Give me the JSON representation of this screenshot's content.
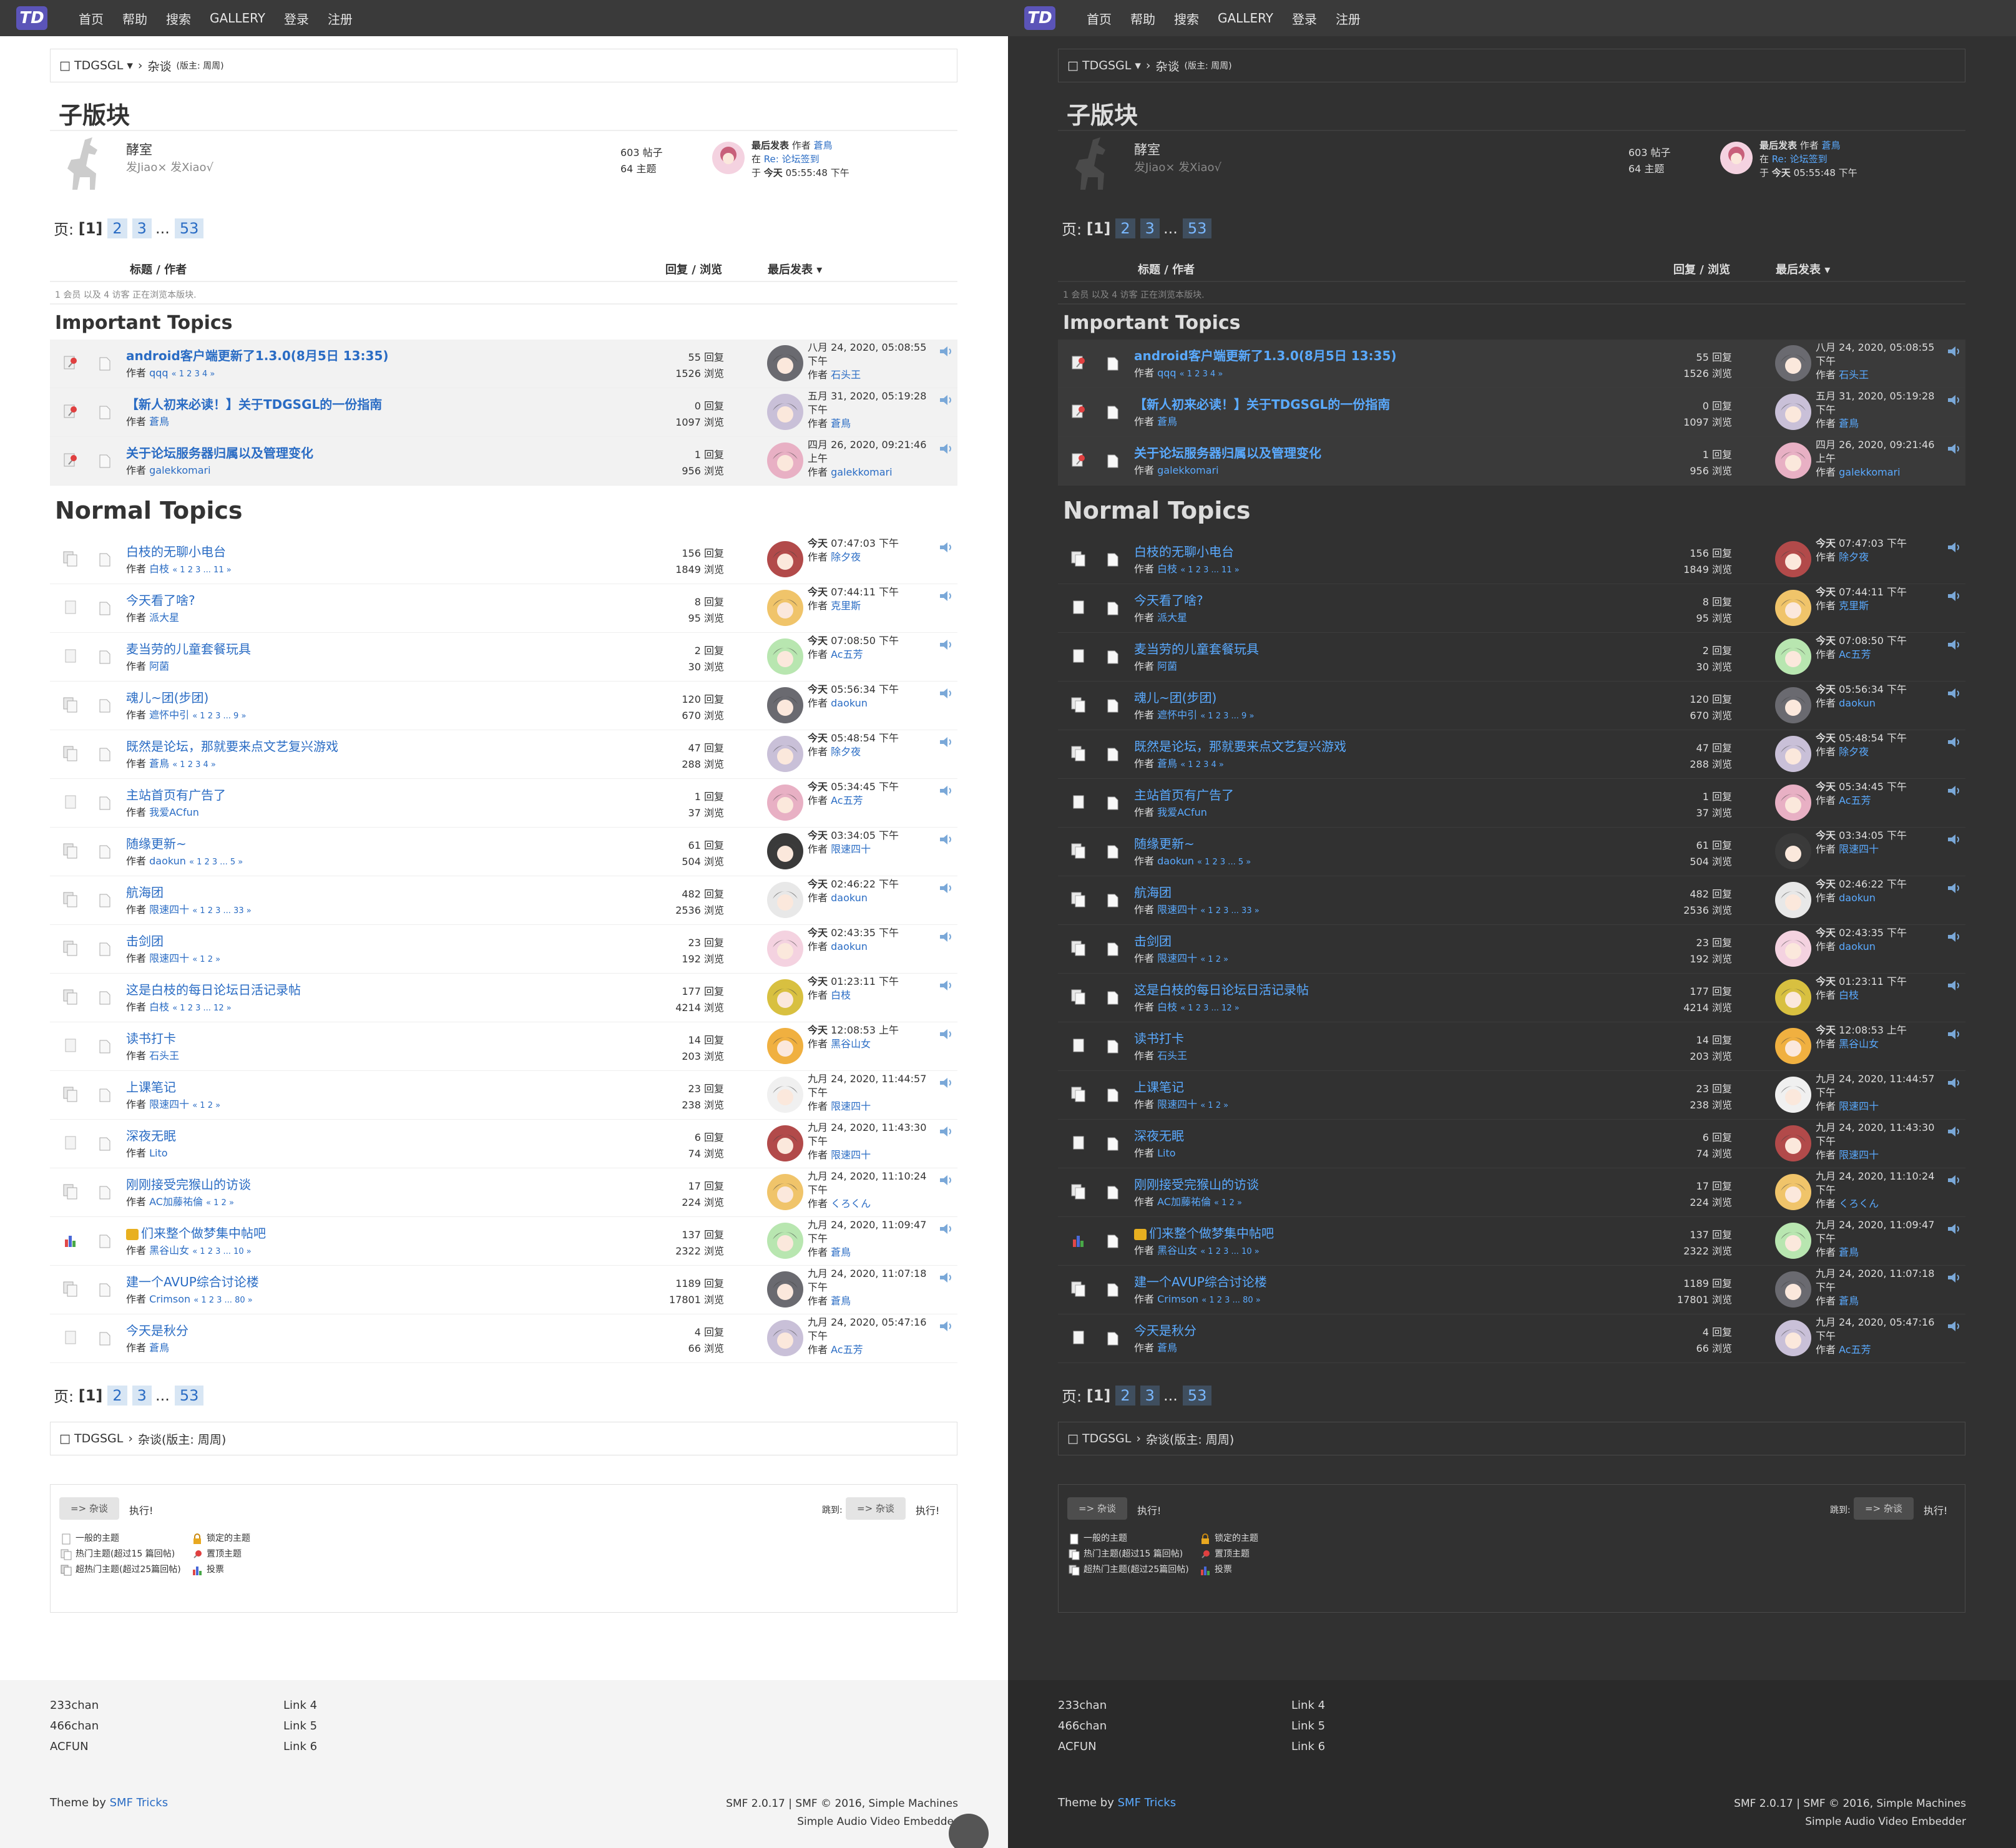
{
  "nav": {
    "logo": "TD",
    "links": [
      "首页",
      "帮助",
      "搜索",
      "GALLERY",
      "登录",
      "注册"
    ]
  },
  "breadcrumb": {
    "forum": "TDGSGL",
    "board": "杂谈",
    "moderator": "(版主: 周周)"
  },
  "subboards": {
    "heading": "子版块",
    "board": {
      "name": "酵室",
      "desc": "发Jiao× 发Xiao√",
      "posts": "603 帖子",
      "topics": "64 主题",
      "last_label": "最后发表",
      "last_by_label": "作者",
      "last_by": "蒼鳥",
      "last_in_label": "在",
      "last_in": "Re: 论坛签到",
      "last_at_label": "于",
      "last_day": "今天",
      "last_time": "05:55:48 下午"
    }
  },
  "pagination": {
    "label": "页:",
    "current": "[1]",
    "pages": [
      "2",
      "3"
    ],
    "ellipsis": "...",
    "last": "53"
  },
  "columns": {
    "subject": "标题 / 作者",
    "replies": "回复 / 浏览",
    "last": "最后发表"
  },
  "online_note": "1 会员 以及 4 访客 正在浏览本版块.",
  "author_label": "作者",
  "important_heading": "Important Topics",
  "normal_heading": "Normal Topics",
  "important_topics": [
    {
      "title": "android客户端更新了1.3.0(8月5日 13:35)",
      "author": "qqq",
      "pages": "« 1 2 3 4 »",
      "replies": "55 回复",
      "views": "1526 浏览",
      "date": "八月 24, 2020, 05:08:55 下午",
      "last_by": "石头王"
    },
    {
      "title": "【新人初来必读！】关于TDGSGL的一份指南",
      "author": "蒼鳥",
      "pages": "",
      "replies": "0 回复",
      "views": "1097 浏览",
      "date": "五月 31, 2020, 05:19:28 下午",
      "last_by": "蒼鳥"
    },
    {
      "title": "关于论坛服务器归属以及管理变化",
      "author": "galekkomari",
      "pages": "",
      "replies": "1 回复",
      "views": "956 浏览",
      "date": "四月 26, 2020, 09:21:46 上午",
      "last_by": "galekkomari"
    }
  ],
  "normal_topics": [
    {
      "title": "白枝的无聊小电台",
      "author": "白枝",
      "pages": "« 1 2 3 ... 11 »",
      "replies": "156 回复",
      "views": "1849 浏览",
      "day": "今天",
      "time": "07:47:03 下午",
      "last_by": "除夕夜"
    },
    {
      "title": "今天看了啥?",
      "author": "派大星",
      "pages": "",
      "replies": "8 回复",
      "views": "95 浏览",
      "day": "今天",
      "time": "07:44:11 下午",
      "last_by": "克里斯"
    },
    {
      "title": "麦当劳的儿童套餐玩具",
      "author": "阿菌",
      "pages": "",
      "replies": "2 回复",
      "views": "30 浏览",
      "day": "今天",
      "time": "07:08:50 下午",
      "last_by": "Ac五芳"
    },
    {
      "title": "魂儿~团(步团)",
      "author": "遮怀中引",
      "pages": "« 1 2 3 ... 9 »",
      "replies": "120 回复",
      "views": "670 浏览",
      "day": "今天",
      "time": "05:56:34 下午",
      "last_by": "daokun"
    },
    {
      "title": "既然是论坛，那就要来点文艺复兴游戏",
      "author": "蒼鳥",
      "pages": "« 1 2 3 4 »",
      "replies": "47 回复",
      "views": "288 浏览",
      "day": "今天",
      "time": "05:48:54 下午",
      "last_by": "除夕夜"
    },
    {
      "title": "主站首页有广告了",
      "author": "我爱ACfun",
      "pages": "",
      "replies": "1 回复",
      "views": "37 浏览",
      "day": "今天",
      "time": "05:34:45 下午",
      "last_by": "Ac五芳"
    },
    {
      "title": "随缘更新~",
      "author": "daokun",
      "pages": "« 1 2 3 ... 5 »",
      "replies": "61 回复",
      "views": "504 浏览",
      "day": "今天",
      "time": "03:34:05 下午",
      "last_by": "限速四十"
    },
    {
      "title": "航海团",
      "author": "限速四十",
      "pages": "« 1 2 3 ... 33 »",
      "replies": "482 回复",
      "views": "2536 浏览",
      "day": "今天",
      "time": "02:46:22 下午",
      "last_by": "daokun"
    },
    {
      "title": "击剑团",
      "author": "限速四十",
      "pages": "« 1 2 »",
      "replies": "23 回复",
      "views": "192 浏览",
      "day": "今天",
      "time": "02:43:35 下午",
      "last_by": "daokun"
    },
    {
      "title": "这是白枝的每日论坛日活记录帖",
      "author": "白枝",
      "pages": "« 1 2 3 ... 12 »",
      "replies": "177 回复",
      "views": "4214 浏览",
      "day": "今天",
      "time": "01:23:11 下午",
      "last_by": "白枝"
    },
    {
      "title": "读书打卡",
      "author": "石头王",
      "pages": "",
      "replies": "14 回复",
      "views": "203 浏览",
      "day": "今天",
      "time": "12:08:53 上午",
      "last_by": "黑谷山女"
    },
    {
      "title": "上课笔记",
      "author": "限速四十",
      "pages": "« 1 2 »",
      "replies": "23 回复",
      "views": "238 浏览",
      "day": "",
      "time": "九月 24, 2020, 11:44:57 下午",
      "last_by": "限速四十"
    },
    {
      "title": "深夜无眠",
      "author": "Lito",
      "pages": "",
      "replies": "6 回复",
      "views": "74 浏览",
      "day": "",
      "time": "九月 24, 2020, 11:43:30 下午",
      "last_by": "限速四十"
    },
    {
      "title": "刚刚接受完猴山的访谈",
      "author": "AC加藤祐倫",
      "pages": "« 1 2 »",
      "replies": "17 回复",
      "views": "224 浏览",
      "day": "",
      "time": "九月 24, 2020, 11:10:24 下午",
      "last_by": "くろくん"
    },
    {
      "title": "们来整个做梦集中帖吧",
      "author": "黑谷山女",
      "pages": "« 1 2 3 ... 10 »",
      "replies": "137 回复",
      "views": "2322 浏览",
      "day": "",
      "time": "九月 24, 2020, 11:09:47 下午",
      "last_by": "蒼鳥",
      "poll": true
    },
    {
      "title": "建一个AVUP综合讨论楼",
      "author": "Crimson",
      "pages": "« 1 2 3 ... 80 »",
      "replies": "1189 回复",
      "views": "17801 浏览",
      "day": "",
      "time": "九月 24, 2020, 11:07:18 下午",
      "last_by": "蒼鳥"
    },
    {
      "title": "今天是秋分",
      "author": "蒼鳥",
      "pages": "",
      "replies": "4 回复",
      "views": "66 浏览",
      "day": "",
      "time": "九月 24, 2020, 05:47:16 下午",
      "last_by": "Ac五芳"
    }
  ],
  "bottom": {
    "move_btn": "=> 杂谈",
    "exec": "执行!",
    "jump_label": "跳到:",
    "jump_btn": "=> 杂谈",
    "legend": [
      "一般的主题",
      "热门主题(超过15 篇回帖)",
      "超热门主题(超过25篇回帖)",
      "锁定的主题",
      "置顶主题",
      "投票"
    ]
  },
  "footer": {
    "col1": [
      "233chan",
      "466chan",
      "ACFUN"
    ],
    "col2": [
      "Link 4",
      "Link 5",
      "Link 6"
    ],
    "theme_label": "Theme by",
    "theme_link": "SMF Tricks",
    "copy1": "SMF 2.0.17 | SMF © 2016, Simple Machines",
    "copy2": "Simple Audio Video Embedder"
  },
  "colors": {
    "accent": "#2a6cc4",
    "dark_accent": "#5aaaff",
    "logo": "#5b54b8",
    "nav": "#3a3a3a",
    "dark_bg": "#313131"
  }
}
